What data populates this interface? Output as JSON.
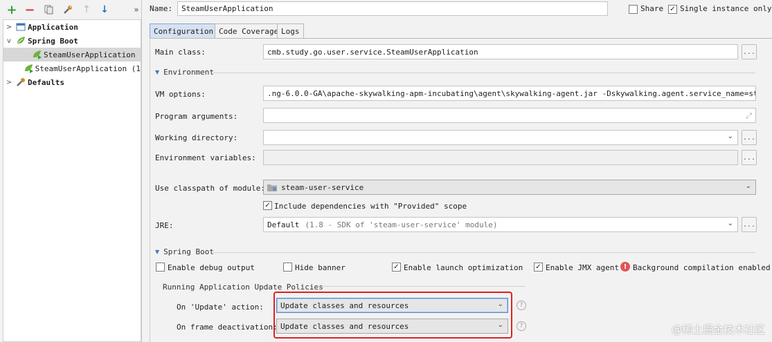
{
  "toolbar": {
    "add_icon": "plus-icon",
    "remove_icon": "minus-icon",
    "copy_icon": "copy-icon",
    "wrench_icon": "wrench-icon",
    "up_icon": "arrow-up-icon",
    "down_icon": "arrow-down-icon",
    "more": "»"
  },
  "tree": {
    "application": "Application",
    "spring_boot": "Spring Boot",
    "item1": "SteamUserApplication",
    "item2": "SteamUserApplication (1",
    "defaults": "Defaults"
  },
  "header": {
    "name_label": "Name:",
    "name_value": "SteamUserApplication",
    "share_label": "Share",
    "share_checked": false,
    "single_instance_label": "Single instance only",
    "single_instance_checked": true
  },
  "tabs": [
    "Configuration",
    "Code Coverage",
    "Logs"
  ],
  "main_class": {
    "label": "Main class:",
    "value": "cmb.study.go.user.service.SteamUserApplication"
  },
  "environment": {
    "section": "Environment",
    "vm_label": "VM options:",
    "vm_value": ".ng-6.0.0-GA\\apache-skywalking-apm-incubating\\agent\\skywalking-agent.jar -Dskywalking.agent.service_name=steam-user",
    "args_label": "Program arguments:",
    "args_value": "",
    "workdir_label": "Working directory:",
    "workdir_value": "",
    "envvars_label": "Environment variables:",
    "envvars_value": ""
  },
  "classpath": {
    "label": "Use classpath of module:",
    "value": "steam-user-service",
    "include_deps_label": "Include dependencies with \"Provided\" scope",
    "include_deps_checked": true
  },
  "jre": {
    "label": "JRE:",
    "value": "Default",
    "hint": "(1.8 - SDK of 'steam-user-service' module)"
  },
  "spring_boot": {
    "section": "Spring Boot",
    "debug_label": "Enable debug output",
    "debug_checked": false,
    "hide_banner_label": "Hide banner",
    "hide_banner_checked": false,
    "launch_opt_label": "Enable launch optimization",
    "launch_opt_checked": true,
    "jmx_label": "Enable JMX agent",
    "jmx_checked": true,
    "bg_compile_label": "Background compilation enabled"
  },
  "update_policies": {
    "title": "Running Application Update Policies",
    "update_action_label": "On 'Update' action:",
    "update_action_value": "Update classes and resources",
    "frame_deactivation_label": "On frame deactivation:",
    "frame_deactivation_value": "Update classes and resources"
  },
  "watermark": "@稀土掘金技术社区",
  "colors": {
    "highlight_box": "#dd2222",
    "selected_tab": "#d6e2f2",
    "add_green": "#3b9b3b",
    "remove_red": "#d9363e"
  }
}
